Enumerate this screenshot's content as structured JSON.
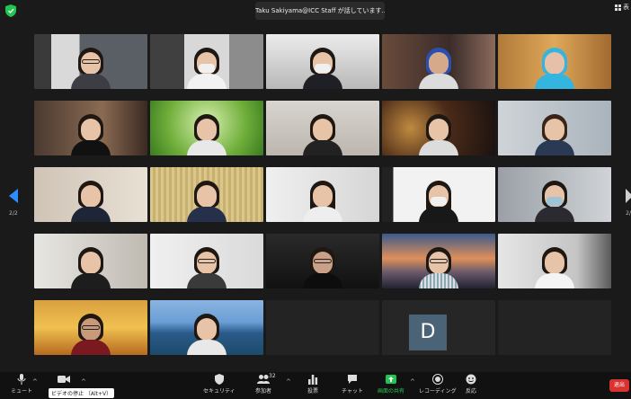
{
  "header": {
    "speaker_banner": "Taku Sakiyama@ICC Staff が話しています...",
    "view_label": "表"
  },
  "gallery": {
    "page_indicator_left": "2/2",
    "page_indicator_right": "2/",
    "avatar_initial": "D"
  },
  "toolbar": {
    "mute_label": "ミュート",
    "video_label": "ビデオの停止",
    "video_tooltip": "ビデオの停止 （Alt+V）",
    "security_label": "セキュリティ",
    "participants_label": "参加者",
    "participants_count": "32",
    "poll_label": "投票",
    "chat_label": "チャット",
    "share_label": "画面の共有",
    "record_label": "レコーディング",
    "reactions_label": "反応",
    "leave_label": "退出"
  },
  "colors": {
    "background": "#1a1a1a",
    "share_accent": "#23c552",
    "leave": "#d9322f",
    "nav_accent": "#2d8cff"
  }
}
